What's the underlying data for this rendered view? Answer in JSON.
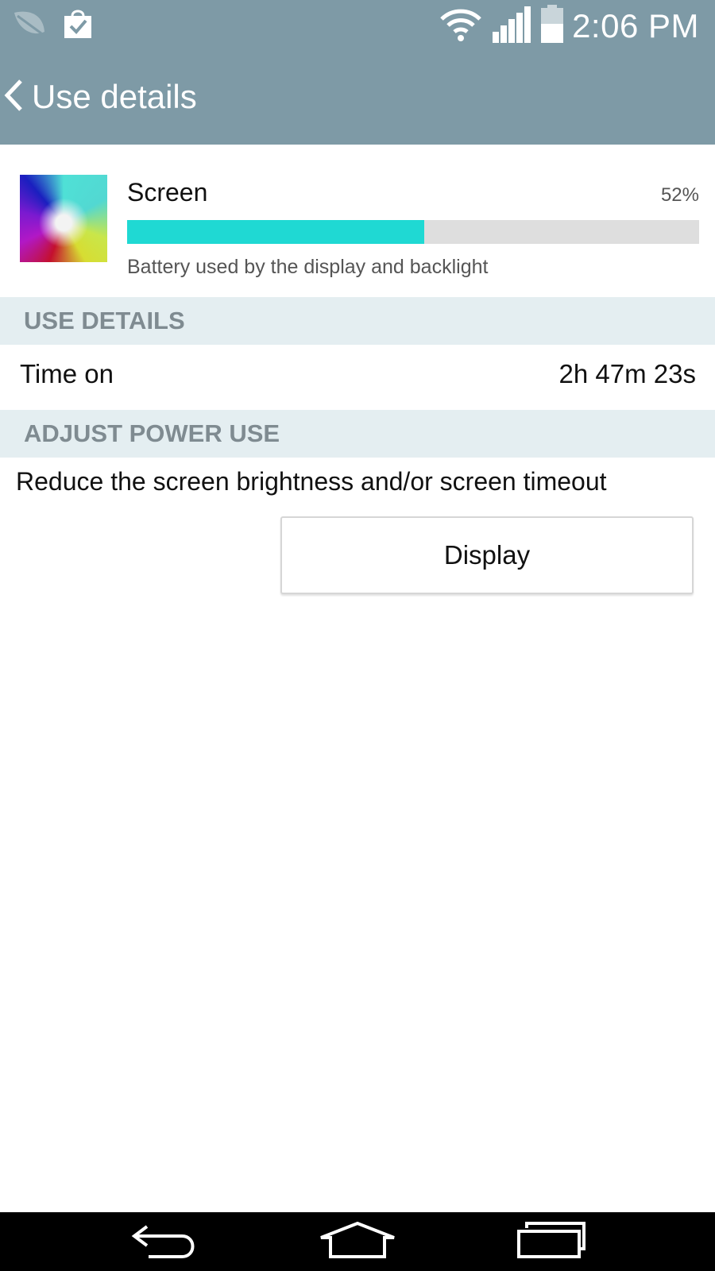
{
  "status_bar": {
    "time": "2:06 PM",
    "icons": [
      "leaf-icon",
      "shopping-bag-check-icon",
      "wifi-icon",
      "cellular-signal-icon",
      "battery-icon"
    ]
  },
  "action_bar": {
    "title": "Use details",
    "back_icon": "chevron-left-icon"
  },
  "summary": {
    "icon": "screen-icon",
    "title": "Screen",
    "percent_label": "52%",
    "percent_value": 52,
    "description": "Battery used by the display and backlight",
    "colors": {
      "progress": "#1fd9d3",
      "track": "#dedede"
    }
  },
  "use_details": {
    "header": "USE DETAILS",
    "rows": [
      {
        "label": "Time on",
        "value": "2h 47m 23s"
      }
    ]
  },
  "adjust_power": {
    "header": "ADJUST POWER USE",
    "description": "Reduce the screen brightness and/or screen timeout",
    "button_label": "Display"
  },
  "nav_bar": {
    "icons": [
      "back-icon",
      "home-icon",
      "recent-apps-icon"
    ]
  },
  "colors": {
    "header_bg": "#7e9aa6",
    "section_bg": "#e4eef1",
    "section_text": "#7f8b91"
  }
}
